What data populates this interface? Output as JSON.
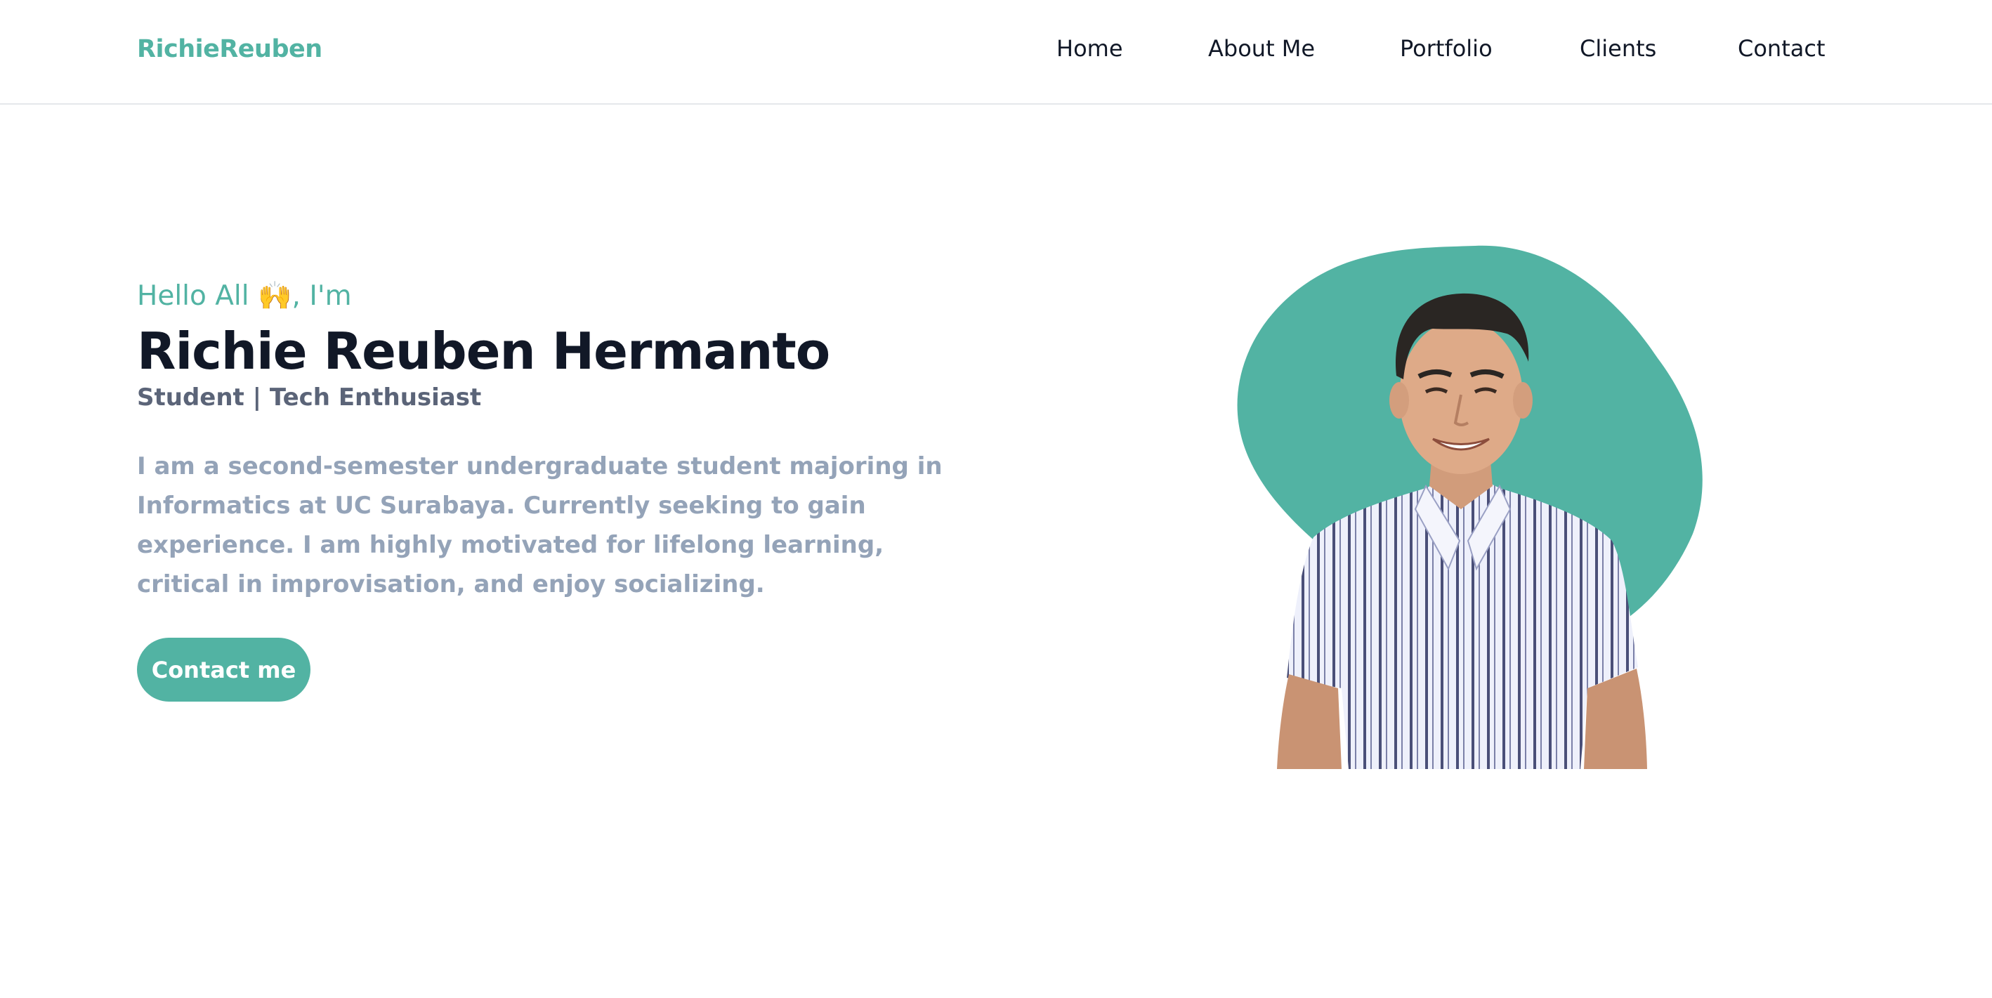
{
  "navbar": {
    "brand": "RichieReuben",
    "links": [
      {
        "label": "Home"
      },
      {
        "label": "About Me"
      },
      {
        "label": "Portfolio"
      },
      {
        "label": "Clients"
      },
      {
        "label": "Contact"
      }
    ]
  },
  "hero": {
    "greeting": "Hello All 🙌, I'm",
    "name": "Richie Reuben Hermanto",
    "subtitle": "Student | Tech Enthusiast",
    "bio": "I am a second-semester undergraduate student majoring in Informatics at UC Surabaya. Currently seeking to gain experience. I am highly motivated for lifelong learning, critical in improvisation, and enjoy socializing.",
    "cta_label": "Contact me"
  },
  "colors": {
    "accent": "#52b3a3",
    "heading": "#111827",
    "subtitle": "#5b6478",
    "body_text": "#94a3b8",
    "background": "#ffffff"
  },
  "icons": {
    "greeting_emoji": "raising-hands-icon",
    "portrait": "profile-photo"
  }
}
